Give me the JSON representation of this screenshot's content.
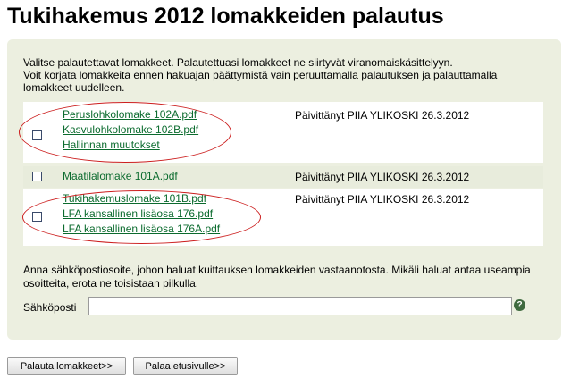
{
  "page": {
    "title": "Tukihakemus 2012 lomakkeiden palautus"
  },
  "intro": {
    "line1": "Valitse palautettavat lomakkeet. Palautettuasi lomakkeet ne siirtyvät viranomaiskäsittelyyn.",
    "line2": "Voit korjata lomakkeita ennen hakuajan päättymistä vain peruuttamalla palautuksen ja palauttamalla lomakkeet uudelleen."
  },
  "groups": [
    {
      "links": [
        "Peruslohkolomake 102A.pdf",
        "Kasvulohkolomake 102B.pdf",
        "Hallinnan muutokset"
      ],
      "updated": "Päivittänyt PIIA YLIKOSKI 26.3.2012",
      "checked": false
    },
    {
      "links": [
        "Maatilalomake 101A.pdf"
      ],
      "updated": "Päivittänyt PIIA YLIKOSKI 26.3.2012",
      "checked": false
    },
    {
      "links": [
        "Tukihakemuslomake 101B.pdf",
        "LFA kansallinen lisäosa 176.pdf",
        "LFA kansallinen lisäosa 176A.pdf"
      ],
      "updated": "Päivittänyt PIIA YLIKOSKI 26.3.2012",
      "checked": false
    }
  ],
  "email": {
    "note": "Anna sähköpostiosoite, johon haluat kuittauksen lomakkeiden vastaanotosta. Mikäli haluat antaa useampia osoitteita, erota ne toisistaan pilkulla.",
    "label": "Sähköposti",
    "value": "",
    "help_icon": "question-icon",
    "help_symbol": "?"
  },
  "buttons": {
    "submit": "Palauta lomakkeet>>",
    "back": "Palaa etusivulle>>"
  },
  "colors": {
    "panel": "#ecefe0",
    "link": "#0b6b2e",
    "annotation": "#cc1f1f"
  }
}
